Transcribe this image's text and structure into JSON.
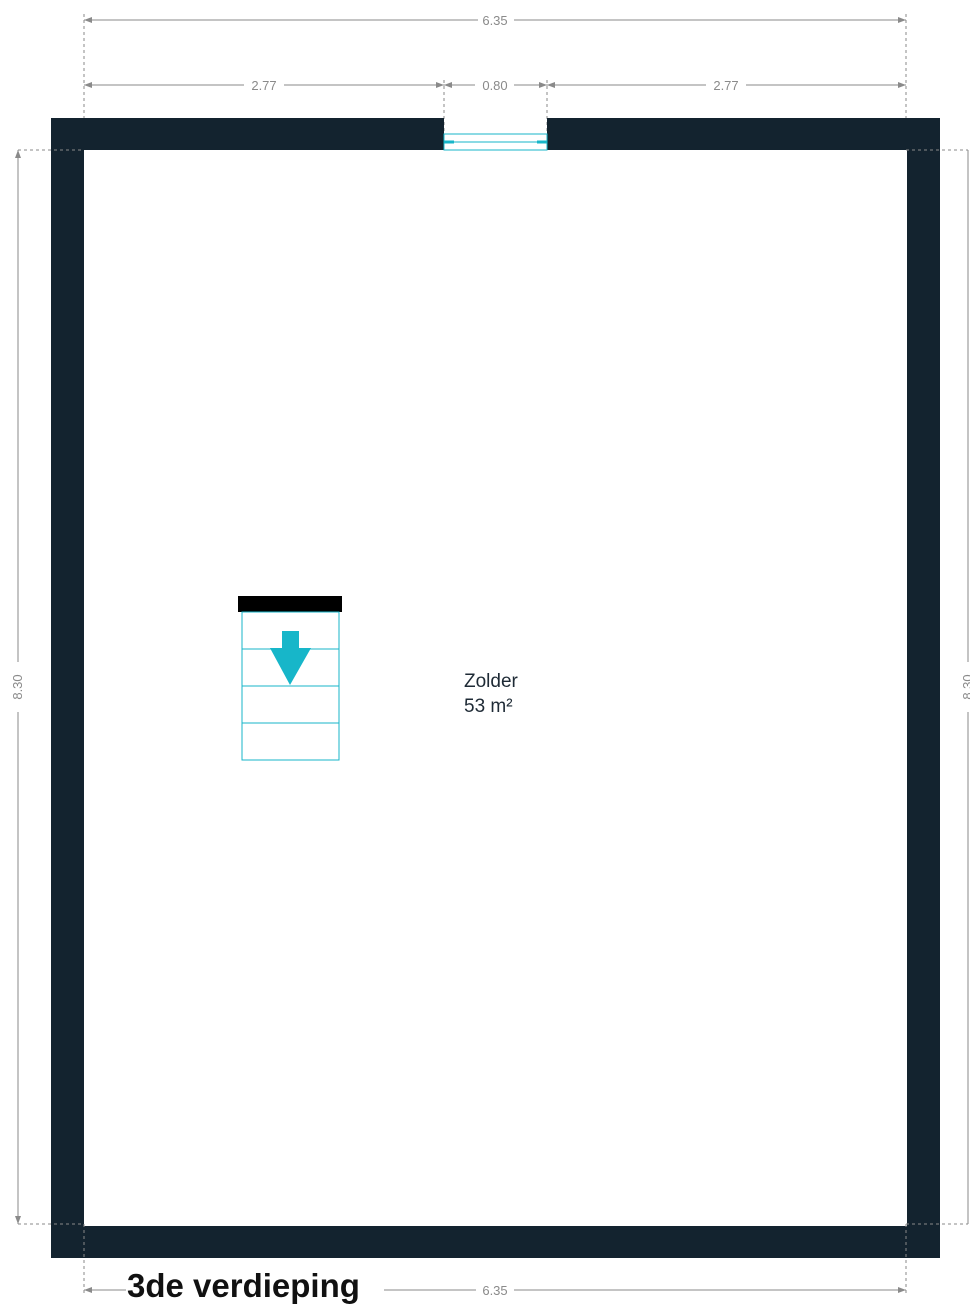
{
  "floor": {
    "title": "3de verdieping"
  },
  "room": {
    "name": "Zolder",
    "area": "53 m²"
  },
  "dimensions": {
    "top_total": "6.35",
    "top_left": "2.77",
    "top_window": "0.80",
    "top_right": "2.77",
    "left_height": "8.30",
    "right_height": "8.30",
    "bottom_total": "6.35"
  },
  "stair": {
    "direction": "down",
    "icon": "arrow-down-icon"
  },
  "colors": {
    "wall": "#13232f",
    "accent": "#17b6c9",
    "dimension": "#8a8a8a",
    "text": "#1e2a35"
  }
}
